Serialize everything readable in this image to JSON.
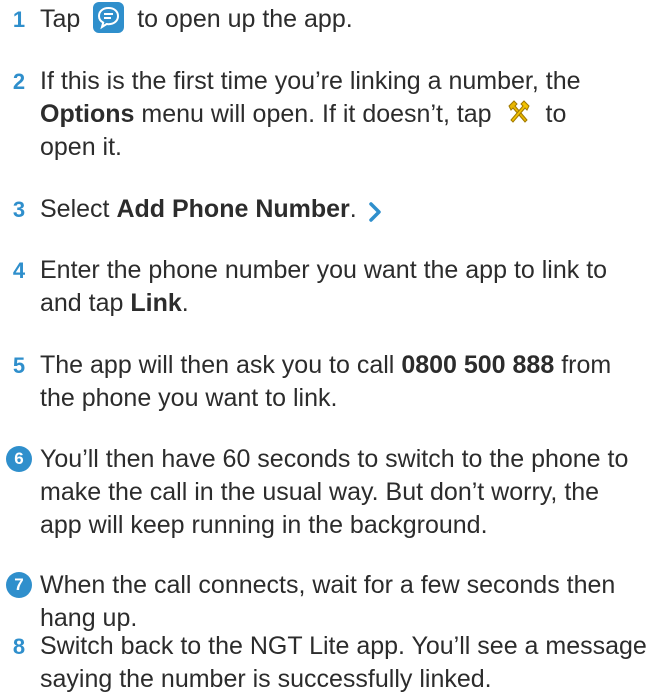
{
  "steps": [
    {
      "num": "1",
      "circle": false,
      "before": "Tap",
      "after": "to open up the app.",
      "icon": "app-icon"
    },
    {
      "num": "2",
      "circle": false,
      "line1": "If this is the first time you’re linking a number, the",
      "bold": "Options",
      "line2_rest": "menu will open. If it doesn’t, tap",
      "icon": "tools-icon",
      "line2_after": "to",
      "line3": "open it."
    },
    {
      "num": "3",
      "circle": false,
      "before": "Select",
      "bold": "Add Phone Number",
      "after": ".",
      "icon": "chevron-right-icon"
    },
    {
      "num": "4",
      "circle": false,
      "line1": "Enter the phone number you want the app to link to",
      "line2_before": "and tap",
      "bold": "Link",
      "line2_after": "."
    },
    {
      "num": "5",
      "circle": false,
      "line1_before": "The app will then ask you to call",
      "bold": "0800 500 888",
      "line1_after": "from",
      "line2": "the phone you want to link."
    },
    {
      "num": "6",
      "circle": true,
      "line1": "You’ll then have 60 seconds to switch to the phone to",
      "line2": "make the call in the usual way. But don’t worry, the",
      "line3": "app will keep running in the background."
    },
    {
      "num": "7",
      "circle": true,
      "line1": "When the call connects, wait for a few seconds then",
      "line2": "hang up."
    },
    {
      "num": "8",
      "circle": false,
      "line1": "Switch back to the NGT Lite app. You’ll see a message",
      "line2": "saying the number is successfully linked."
    }
  ],
  "colors": {
    "accent": "#2f8fcc",
    "text": "#2c2c2c",
    "tools_icon": "#e8b600"
  }
}
